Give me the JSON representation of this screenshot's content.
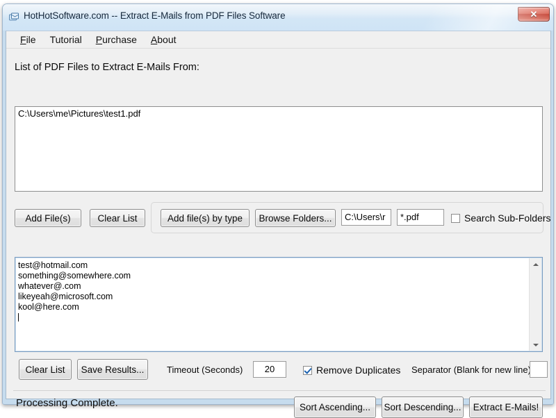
{
  "window": {
    "title": "HotHotSoftware.com -- Extract E-Mails from PDF Files Software",
    "icon": "app-window-icon",
    "close_label": "✕",
    "accent_title_bg": "#cfe4f6",
    "close_button_color": "#c1392a"
  },
  "menu": {
    "items": [
      {
        "mnemonic": "F",
        "rest": "ile"
      },
      {
        "mnemonic": "",
        "rest": "Tutorial"
      },
      {
        "mnemonic": "P",
        "rest": "urchase"
      },
      {
        "mnemonic": "A",
        "rest": "bout"
      }
    ]
  },
  "file_list": {
    "label": "List of PDF Files to Extract E-Mails From:",
    "value": "C:\\Users\\me\\Pictures\\test1.pdf"
  },
  "file_buttons": {
    "add_files": "Add File(s)",
    "clear_list": "Clear List",
    "add_by_type": "Add file(s) by type",
    "browse_folders": "Browse Folders...",
    "folder_path_value": "C:\\Users\\r",
    "folder_path_placeholder": "",
    "file_mask_value": "*.pdf",
    "file_mask_placeholder": "",
    "search_subfolders_label": "Search Sub-Folders",
    "search_subfolders_checked": false
  },
  "results": {
    "emails": [
      "test@hotmail.com",
      "something@somewhere.com",
      "whatever@.com",
      "likeyeah@microsoft.com",
      "kool@here.com"
    ],
    "scroll_up_icon": "triangle-up-icon",
    "scroll_down_icon": "triangle-down-icon"
  },
  "results_controls": {
    "clear_list": "Clear List",
    "save_results": "Save Results...",
    "timeout_label": "Timeout (Seconds)",
    "timeout_value": "20",
    "remove_duplicates_label": "Remove Duplicates",
    "remove_duplicates_checked": true,
    "separator_label": "Separator (Blank for new line)",
    "separator_value": ""
  },
  "status": {
    "text": "Processing Complete."
  },
  "action_buttons": {
    "sort_ascending": "Sort Ascending...",
    "sort_descending": "Sort Descending...",
    "extract": "Extract E-Mails!"
  }
}
